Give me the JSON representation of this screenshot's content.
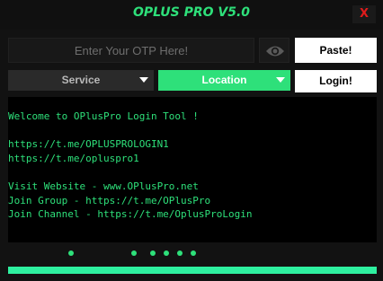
{
  "window": {
    "title": "OPLUS PRO V5.0",
    "close_label": "X"
  },
  "otp": {
    "placeholder": "Enter Your OTP Here!",
    "value": ""
  },
  "toolbar": {
    "paste_label": "Paste!",
    "login_label": "Login!"
  },
  "service_dropdown": {
    "selected": "Service"
  },
  "location_dropdown": {
    "selected": "Location"
  },
  "console": {
    "lines": [
      "Welcome to OPlusPro Login Tool !",
      "",
      "https://t.me/OPLUSPROLOGIN1",
      "https://t.me/opluspro1",
      "",
      "Visit Website - www.OPlusPro.net",
      "Join Group - https://t.me/OPlusPro",
      "Join Channel - https://t.me/OplusProLogin"
    ]
  },
  "progress": {
    "fraction": 1.0
  },
  "colors": {
    "accent": "#2ee07a",
    "close": "#e01b1b",
    "progress": "#2ef0a0"
  },
  "icons": {
    "visibility": "eye-icon",
    "dropdown": "chevron-down-icon"
  }
}
